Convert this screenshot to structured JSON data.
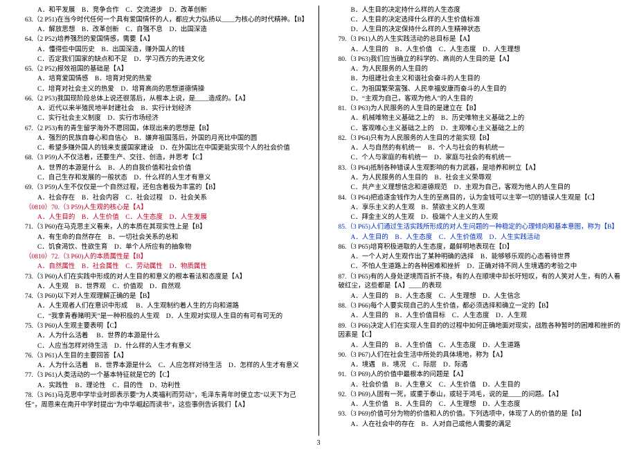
{
  "page_number": "3",
  "left_column": [
    {
      "cls": "indent1",
      "text": "A．和平发展    B．竞争合作    C．交流进步    D．改革创新"
    },
    {
      "cls": "indent2",
      "text": "63.（2 P51)在当今时代任何一个具有爱国情怀的人，都应大力弘扬以﻿____﻿为核心的时代精神。【B】"
    },
    {
      "cls": "indent1",
      "text": "A．解放思想    B．改革创新    C．自强不息    D．出国深造"
    },
    {
      "cls": "indent2",
      "text": "64.（2 P52)培养强烈的爱国情感，需要【A】"
    },
    {
      "cls": "indent1",
      "text": "A．懂得些中国历史    B．出国深造，赚外国人的钱"
    },
    {
      "cls": "indent1",
      "text": "C．否定我们国家的缺点和不足    D．学习西方的先进文化"
    },
    {
      "cls": "indent2",
      "text": "65.（2 P52)报效祖国的基础是【A】"
    },
    {
      "cls": "indent1",
      "text": "A．培育爱国情感    B．培育对党的热爱"
    },
    {
      "cls": "indent1",
      "text": "C．培育对社会主义的热爱    D．培育高尚的思想道德情操"
    },
    {
      "cls": "indent2",
      "text": "66.（2 P53)我国现阶段总体上说还很落后，从根本上说，是﻿____﻿造成的。【A】"
    },
    {
      "cls": "indent1",
      "text": "A．近代以来半殖民地半封建社会    B．实行计划经济"
    },
    {
      "cls": "indent1",
      "text": "C．实行社会主义制度    D．实行市场经济"
    },
    {
      "cls": "indent2",
      "text": "67.（2 P53)有的青生留学海外不愿回国，体现出来的思想是【B】"
    },
    {
      "cls": "indent1",
      "text": "A．强烈的民族自尊心和自信心    B．嫌弃祖国落后，外国的月亮比中国的圆"
    },
    {
      "cls": "indent1",
      "text": "C．希望多赚外国人的钱来支援国家建设    D．在外国比在中国更能实现个人的社会价值"
    },
    {
      "cls": "indent2",
      "text": "68.（3 P59)人不仅活着，还要生产、交往、创造，并思考【C】"
    },
    {
      "cls": "indent1",
      "text": "A．世界的本源是什么    B．人的自我价值和社会价值"
    },
    {
      "cls": "indent1",
      "text": "C．自己生存和发展的一般状态    D．什么样的人生才有意义"
    },
    {
      "cls": "indent2",
      "text": "69.（3 P59)人生不仅仅是一个自然过程，还包含着极为丰富的【B】"
    },
    {
      "cls": "indent1",
      "text": "A．社会存在    B．社会内容    C．社会过程    D．社会关系"
    },
    {
      "cls": "indent2 red",
      "text": "（0810）70.（3 P59)人生观的核心是【A】"
    },
    {
      "cls": "indent1 red",
      "text": "A．人生目的    B．人生价值    C．人生态度    D．人生发展"
    },
    {
      "cls": "indent2",
      "text": "71.（3 P60)在马克思主义看来，人的本质在其现实性上是【B】"
    },
    {
      "cls": "indent1",
      "text": "A．有生命的自然存在    B．一切社会关系的总和"
    },
    {
      "cls": "indent1",
      "text": "C．饥食渴饮、性欲生育    D．单个人所应有的抽象物"
    },
    {
      "cls": "indent2 red",
      "text": "（0810）72.（3 P60)人的本质属性是【B】"
    },
    {
      "cls": "indent1 red",
      "text": "A．自然属性    B．社会属性    C．劳动属性    D．物质属性"
    },
    {
      "cls": "indent2",
      "text": "73.（3 P60)人们在实践中形成的对人生目的和意义的根本看法和态度是【A】"
    },
    {
      "cls": "indent1",
      "text": "A．人生观    B．世界观    C．价值观    D．自然观"
    },
    {
      "cls": "indent2",
      "text": "74.（3 P60)以下对人生观理解正确的是【B】"
    },
    {
      "cls": "indent1",
      "text": "A．人生观者人们在意识中形成     B．人生观制约着人生的方向和道路"
    },
    {
      "cls": "indent1",
      "text": "C．“我拿青春赌明天”是一种积极的人生观    D．人生观对实现人生目的有可有可无的"
    },
    {
      "cls": "indent2",
      "text": "75.（3 P60)人生观主要表明【C】"
    },
    {
      "cls": "indent1",
      "text": "A．人为什么活着     B．世界的本源是什么"
    },
    {
      "cls": "indent1",
      "text": "C．人应当怎样对待生活    D．什么样的人生才有意义"
    },
    {
      "cls": "indent2",
      "text": "76.（3 P61)人生目的主要回答【A】"
    },
    {
      "cls": "indent1",
      "text": "A．人为什么活着    B．世界本源是什么    C．人应怎样对待生活    D．怎样的人生才有意义"
    },
    {
      "cls": "indent2",
      "text": "77.（3 P61)人类活动的一个基本特征就是它的【C】"
    },
    {
      "cls": "indent1",
      "text": "A．实践性    B．理论性    C．目的性    D．功利性"
    },
    {
      "cls": "indent2",
      "text": "78.（3 P61)马克思中学毕业时即表示要“为人类福利而劳动”，毛泽东青年时便立志“以天下为己任”，周恩来在南开中学时提出“为中华崛起而读书”，这些事例告诉我们【A】"
    }
  ],
  "right_column": [
    {
      "cls": "indent1",
      "text": "B．人生目的决定持什么样的人生态度"
    },
    {
      "cls": "indent1",
      "text": "C．人生目的决定选择什么样的人生价值标准"
    },
    {
      "cls": "indent1",
      "text": "D．人生目的决定保持什么样的人生精神状态"
    },
    {
      "cls": "indent2",
      "text": "79.（3 P61)人的人生实践活动的总目标是【A】"
    },
    {
      "cls": "indent1",
      "text": "A．人生目的    B．人生价值    C．人生态度    D．人生理想"
    },
    {
      "cls": "indent2",
      "text": "80.（3 P63)我们应当确立的科学的、高尚的人生目的是【A】"
    },
    {
      "cls": "indent1",
      "text": "A．为人民服务的人生目的"
    },
    {
      "cls": "indent1",
      "text": "B．为组建社会主义和谐社会奋斗的人生目的"
    },
    {
      "cls": "indent1",
      "text": "C．为祖国繁荣富强、人民幸福安康而奋斗的人生目的"
    },
    {
      "cls": "indent1",
      "text": "D．“主观为自己，客观为他人”的人生目的"
    },
    {
      "cls": "indent2",
      "text": "81.（3 P63)为人民服务的人生目的是建立在【B】"
    },
    {
      "cls": "indent1",
      "text": "A．机械唯物主义基础之上的    B．历史唯物主义基础之上的"
    },
    {
      "cls": "indent1",
      "text": "C．客观唯心主义基础之上的    D．主观唯心主义基础之上的"
    },
    {
      "cls": "indent2",
      "text": "82.（3 P64)只有为人民服务的人生目的才能实现【B】"
    },
    {
      "cls": "indent1",
      "text": "A．人与自然的有机统一    B．个人与社会的有机统一"
    },
    {
      "cls": "indent1",
      "text": "C．个人与家庭的有机统一    D．家庭与社会的有机统一"
    },
    {
      "cls": "indent2",
      "text": "83.（3 P64)抵制各种错误人生观影响的有力武器，是培养和树立【A】"
    },
    {
      "cls": "indent1",
      "text": "A．为人民服务的人生目的    B．社会主义荣辱观"
    },
    {
      "cls": "indent1",
      "text": "C．共产主义理想信念和道德规范    D．主观为自己，客观为他人的人生目的"
    },
    {
      "cls": "indent2",
      "text": "84.（3 P64)把追逐金钱作为人生的至高目的，认为金钱可以主宰一切的错误人生观是【C】"
    },
    {
      "cls": "indent1",
      "text": "A．享乐主义的人生观    B．禁欲主义的人生观"
    },
    {
      "cls": "indent1",
      "text": "C．拜金主义的人生观    D．极端个人主义的人生观"
    },
    {
      "cls": "indent2 blue",
      "text": "85.（3 P65)人们通过生活实践所形成的对人生问题的一种稳定的心理倾向和基本意图，称为【B】"
    },
    {
      "cls": "indent1 blue",
      "text": "A．人生目的    B．人生态度    C．人生价值观    D．人生实践活动"
    },
    {
      "cls": "indent2",
      "text": "86.（3 P65)培育积极进取的人生态度，最鲜明地表现在【D】"
    },
    {
      "cls": "indent1",
      "text": "A．一个人对人生观作出了某种明确的选择    B．能够够乐观的心态看待世界"
    },
    {
      "cls": "indent1",
      "text": "C．不怕人生道路上的各种困难和挫折    D．正确对待不同人生境遇的考验之中"
    },
    {
      "cls": "indent2",
      "text": "87.（3 P65)有的人身处逆境而百折不挠，有的人在顺境中却长吁短叹，有的人笑对人生，有的人看破红尘，这些都是【A】____的表现"
    },
    {
      "cls": "indent1",
      "text": "A．人生目的    B．人生态度    C．人生理想    D．人生信念"
    },
    {
      "cls": "indent2",
      "text": "88.（3 P66)每个人要实现自己的人生价值，都必须选择和确立一定的【B】"
    },
    {
      "cls": "indent1",
      "text": "A．人生目的    B．人生价值目标    C．人生态度    D．人生观"
    },
    {
      "cls": "indent2",
      "text": "89.（3 P66)决定人们在实现人生目的的过程中如何正确地面对现实，战胜各种暂时的困难和挫折的因素是【C】"
    },
    {
      "cls": "indent1",
      "text": "A．人生目的    B．人生价值    C．人生态度    D．人生道路"
    },
    {
      "cls": "indent2",
      "text": "90.（3 P67)人们在社会生活中所处的具体境地，称为【A】"
    },
    {
      "cls": "indent1",
      "text": "A．境遇    B．境况    C．际层    D．际遇"
    },
    {
      "cls": "indent2",
      "text": "91.（3 P69)人的价值中最根本的问题是【A】"
    },
    {
      "cls": "indent1",
      "text": "A．社会价值    B．人生意义    C．人生价值    D．人生目的"
    },
    {
      "cls": "indent2",
      "text": "92.（3 P69)人固有一死，或重于泰山，或轻于鸿毛，说的是﻿____﻿的问题。【A】"
    },
    {
      "cls": "indent1",
      "text": "A．人生价值    B．人生目的    C．人生理想    D．人生态度"
    },
    {
      "cls": "indent2",
      "text": "93.（3 P69)价值可分为物的价值和人的价值。下列选项中，体现了人的价值的是【B】"
    },
    {
      "cls": "indent1",
      "text": "A．人在社会中的存在    B．人对自己或他人需要的满足"
    }
  ]
}
